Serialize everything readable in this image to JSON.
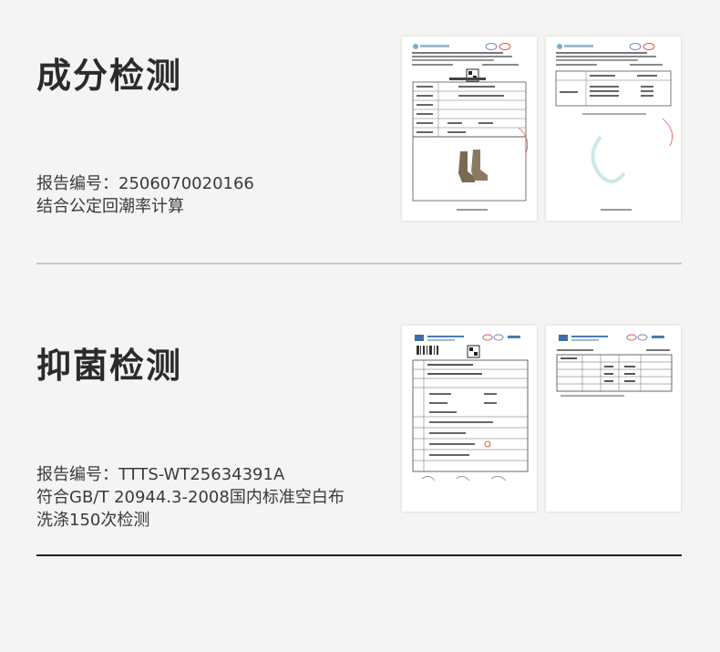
{
  "sections": [
    {
      "title": "成分检测",
      "lines": [
        "报告编号：2506070020166",
        "结合公定回潮率计算"
      ]
    },
    {
      "title": "抑菌检测",
      "lines": [
        "报告编号：TTTS-WT25634391A",
        "符合GB/T 20944.3-2008国内标准空白布",
        "洗涤150次检测"
      ]
    }
  ],
  "colors": {
    "background": "#f4f4f4",
    "divider_light": "#c8c8c8",
    "divider_dark": "#1e1e1e",
    "stamp_red": "#e0584c"
  },
  "thumbnails": [
    {
      "name": "composition-report-page-1",
      "icon": "report-document-icon"
    },
    {
      "name": "composition-report-page-2",
      "icon": "report-document-icon"
    },
    {
      "name": "antibacterial-report-page-1",
      "icon": "report-document-icon"
    },
    {
      "name": "antibacterial-report-page-2",
      "icon": "report-document-icon"
    }
  ]
}
